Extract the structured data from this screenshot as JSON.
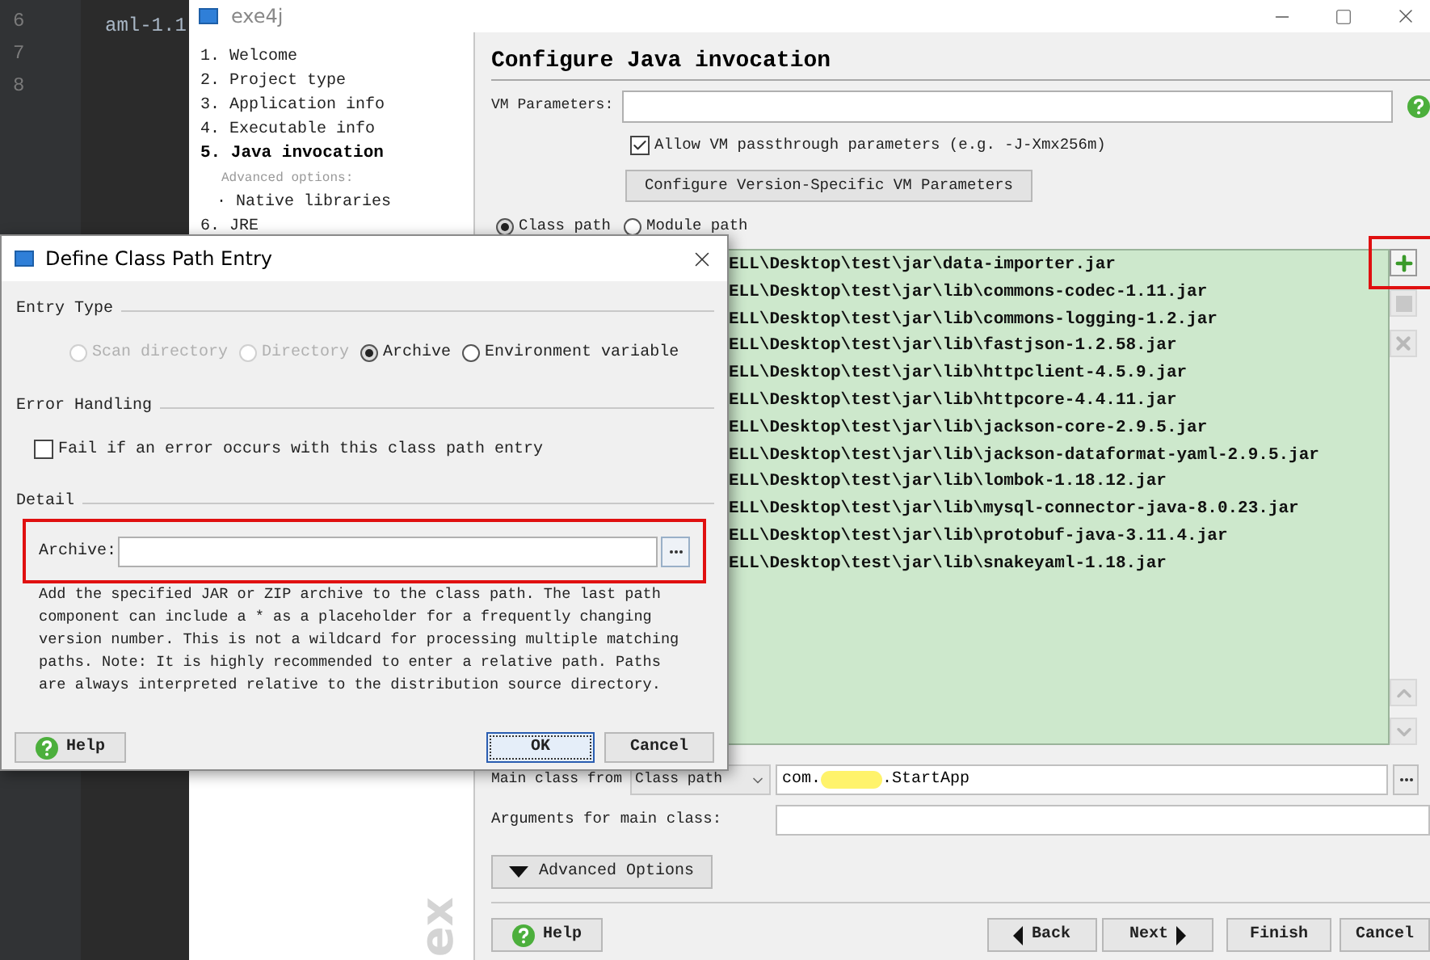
{
  "editor": {
    "line_numbers": [
      "6",
      "7",
      "8"
    ],
    "code_text": "aml-1.1"
  },
  "window": {
    "title": "exe4j"
  },
  "steps": [
    {
      "label": "1. Welcome",
      "kind": "step",
      "current": false
    },
    {
      "label": "2. Project type",
      "kind": "step",
      "current": false
    },
    {
      "label": "3. Application info",
      "kind": "step",
      "current": false
    },
    {
      "label": "4. Executable info",
      "kind": "step",
      "current": false
    },
    {
      "label": "5. Java invocation",
      "kind": "step",
      "current": true
    },
    {
      "label": "Advanced options:",
      "kind": "heading",
      "current": false
    },
    {
      "label": "· Native libraries",
      "kind": "sub",
      "current": false
    },
    {
      "label": "6. JRE",
      "kind": "step",
      "current": false
    }
  ],
  "sidebar_logo": "ex",
  "page": {
    "heading": "Configure Java invocation",
    "vm_parameters": {
      "label": "VM Parameters:"
    },
    "allow_passthrough": {
      "label": "Allow VM passthrough parameters (e.g. -J-Xmx256m)",
      "checked": true
    },
    "version_button": "Configure Version-Specific VM Parameters",
    "path_modes": [
      {
        "label": "Class path",
        "selected": true
      },
      {
        "label": "Module path",
        "selected": false
      }
    ],
    "class_path_entries": [
      "ELL\\Desktop\\test\\jar\\data-importer.jar",
      "ELL\\Desktop\\test\\jar\\lib\\commons-codec-1.11.jar",
      "ELL\\Desktop\\test\\jar\\lib\\commons-logging-1.2.jar",
      "ELL\\Desktop\\test\\jar\\lib\\fastjson-1.2.58.jar",
      "ELL\\Desktop\\test\\jar\\lib\\httpclient-4.5.9.jar",
      "ELL\\Desktop\\test\\jar\\lib\\httpcore-4.4.11.jar",
      "ELL\\Desktop\\test\\jar\\lib\\jackson-core-2.9.5.jar",
      "ELL\\Desktop\\test\\jar\\lib\\jackson-dataformat-yaml-2.9.5.jar",
      "ELL\\Desktop\\test\\jar\\lib\\lombok-1.18.12.jar",
      "ELL\\Desktop\\test\\jar\\lib\\mysql-connector-java-8.0.23.jar",
      "ELL\\Desktop\\test\\jar\\lib\\protobuf-java-3.11.4.jar",
      "ELL\\Desktop\\test\\jar\\lib\\snakeyaml-1.18.jar"
    ],
    "side_buttons": [
      {
        "kind": "add",
        "disabled": false,
        "highlighted": true
      },
      {
        "kind": "edit",
        "disabled": true,
        "highlighted": false
      },
      {
        "kind": "remove",
        "disabled": true,
        "highlighted": false
      },
      {
        "kind": "up",
        "disabled": true,
        "highlighted": false
      },
      {
        "kind": "down",
        "disabled": true,
        "highlighted": false
      }
    ],
    "main_class": {
      "label": "Main class from",
      "source": "Class path",
      "value_start": "com.",
      "value_end": ".StartApp"
    },
    "arguments": {
      "label": "Arguments for main class:"
    },
    "advanced_button": "Advanced Options",
    "buttons": [
      {
        "label": "Help",
        "kind": "help"
      },
      {
        "label": "Back",
        "kind": "back"
      },
      {
        "label": "Next",
        "kind": "next"
      },
      {
        "label": "Finish",
        "kind": "plain"
      },
      {
        "label": "Cancel",
        "kind": "plain"
      }
    ]
  },
  "dialog": {
    "title": "Define Class Path Entry",
    "entry_type": {
      "label": "Entry Type",
      "options": [
        {
          "label": "Scan directory",
          "selected": false,
          "disabled": true
        },
        {
          "label": "Directory",
          "selected": false,
          "disabled": true
        },
        {
          "label": "Archive",
          "selected": true,
          "disabled": false
        },
        {
          "label": "Environment variable",
          "selected": false,
          "disabled": false
        }
      ]
    },
    "error_handling": {
      "label": "Error Handling",
      "fail_option": {
        "label": "Fail if an error occurs with this class path entry",
        "checked": false
      }
    },
    "detail": {
      "label": "Detail",
      "archive_label": "Archive:",
      "highlighted": true,
      "description": "Add the specified JAR or ZIP archive to the class path. The last path component can include a * as a placeholder for a frequently changing version number. This is not a wildcard for processing multiple matching paths. Note: It is highly recommended to enter a relative path. Paths are always interpreted relative to the distribution source directory."
    },
    "buttons": [
      {
        "label": "Help",
        "kind": "help"
      },
      {
        "label": "OK",
        "kind": "default"
      },
      {
        "label": "Cancel",
        "kind": "plain"
      }
    ]
  }
}
